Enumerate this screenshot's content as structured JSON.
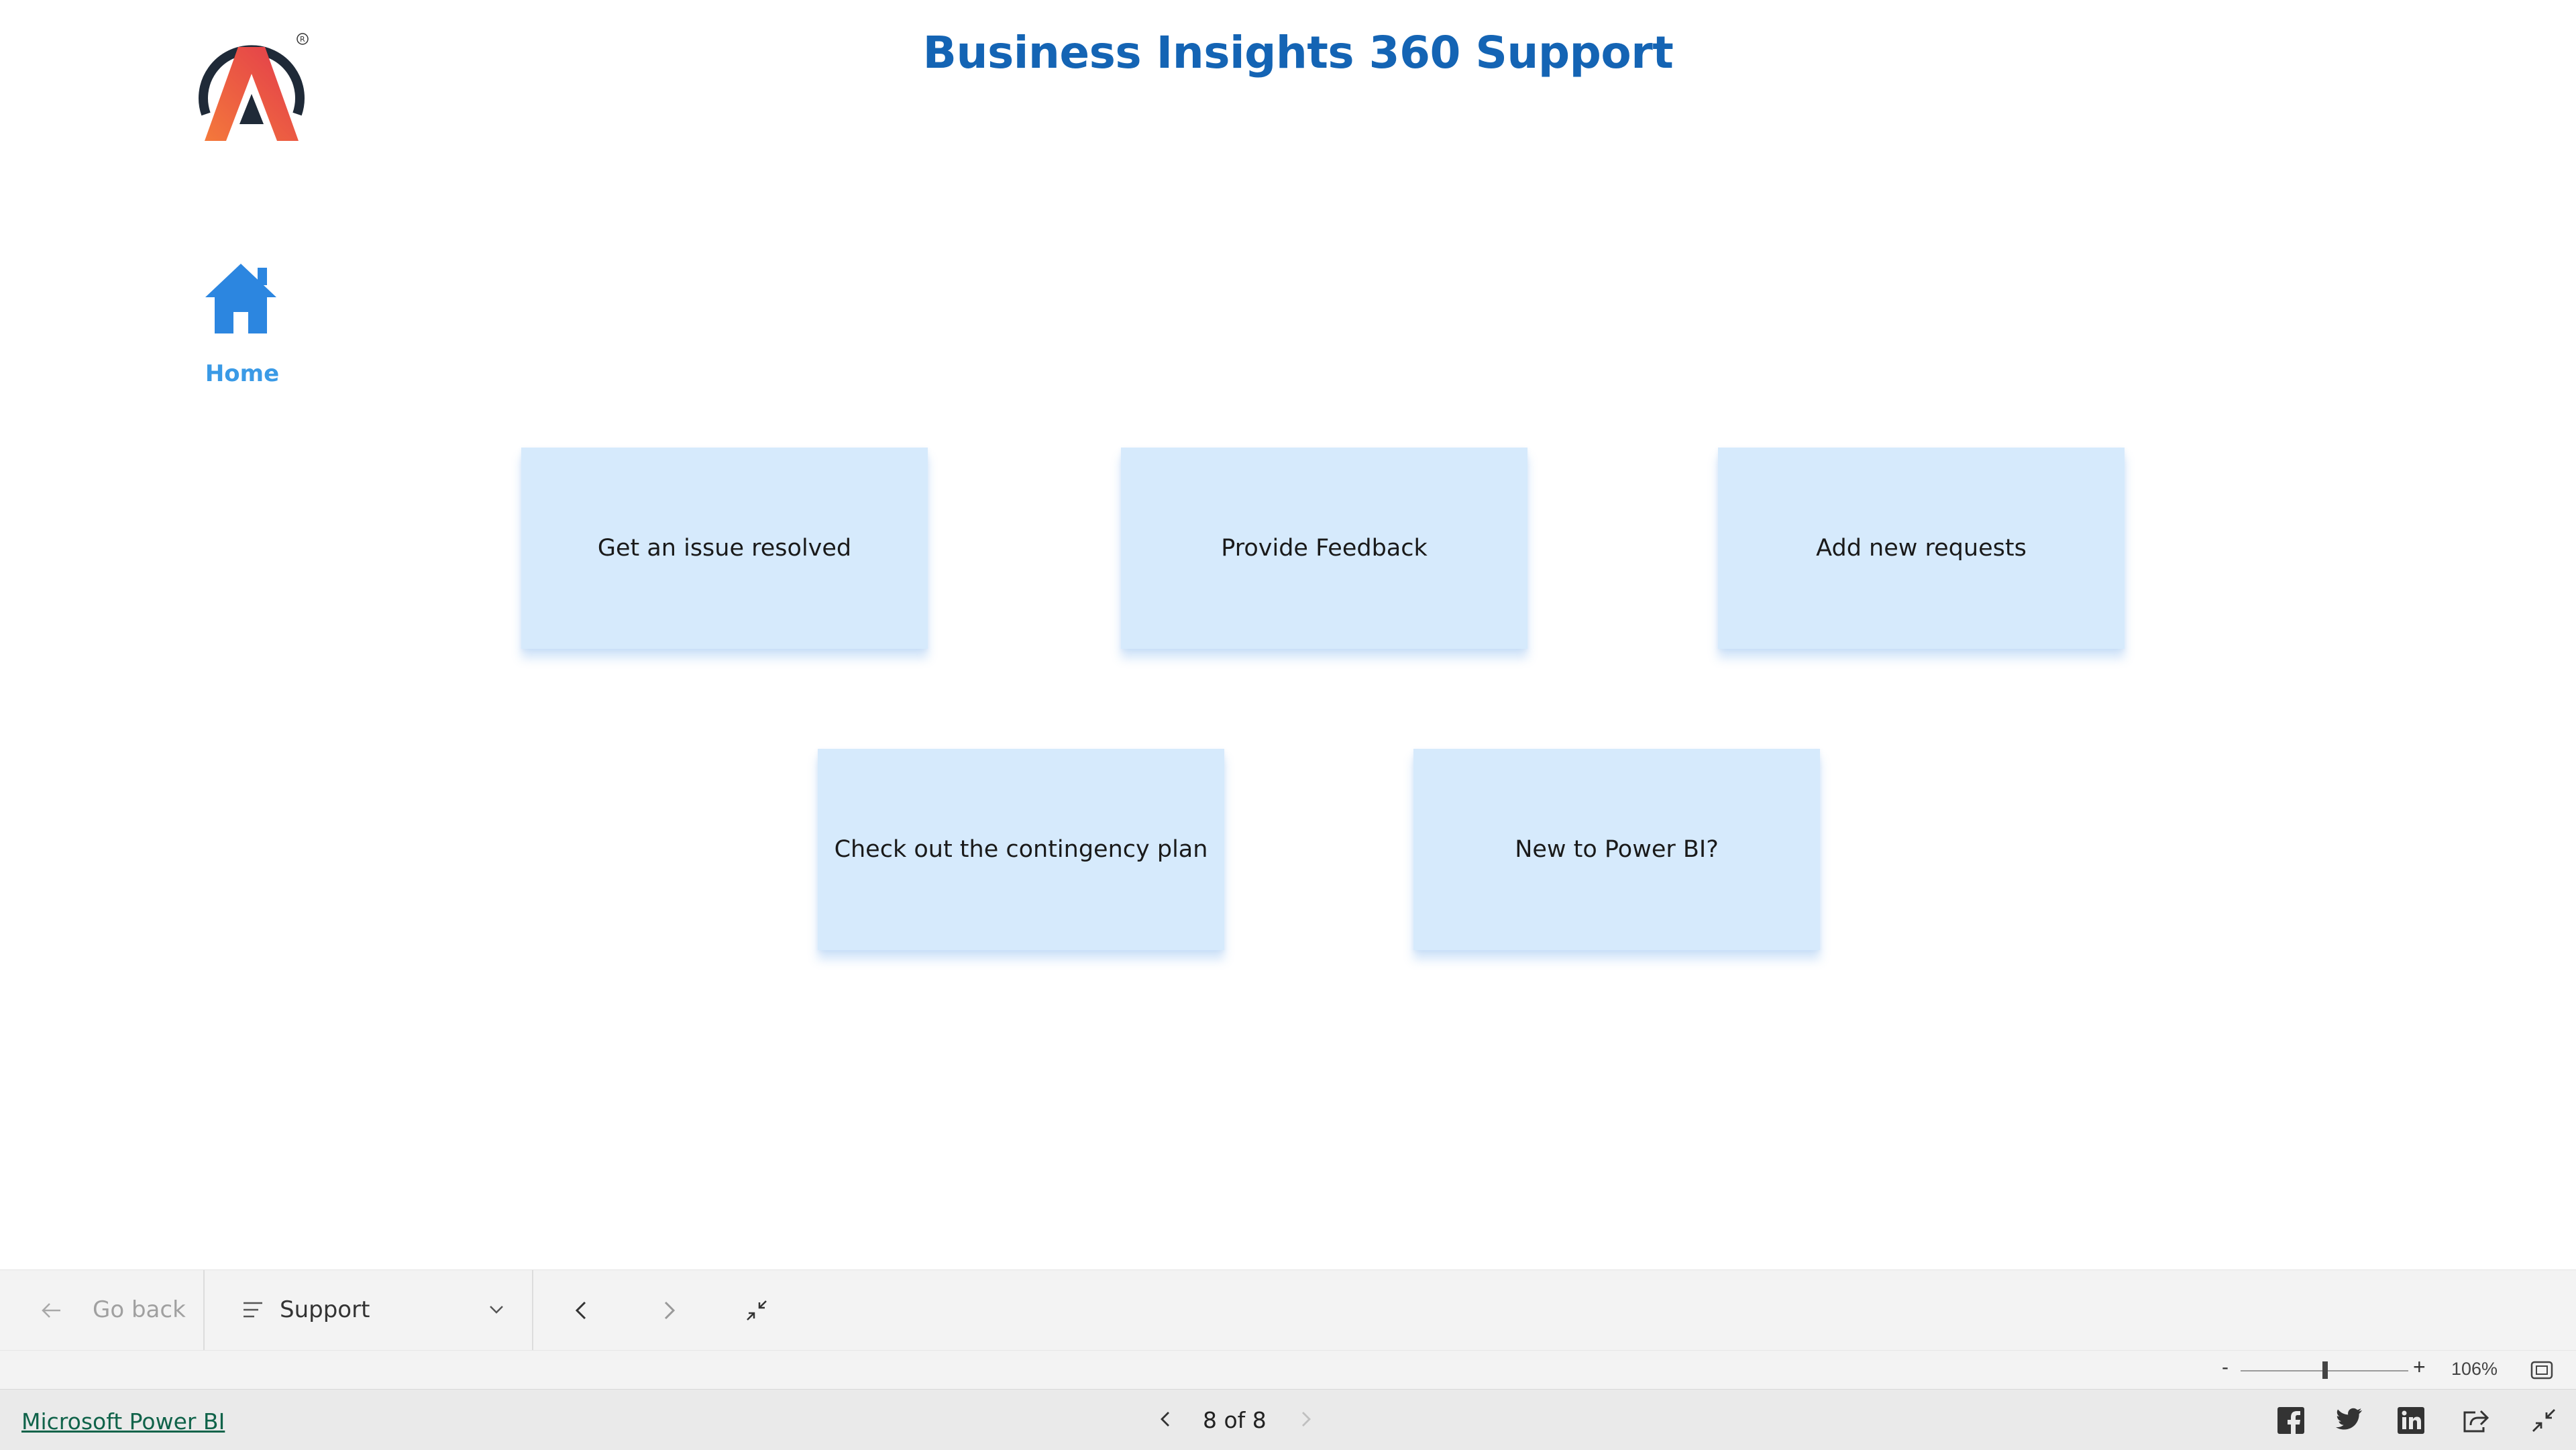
{
  "report": {
    "title": "Business Insights 360 Support",
    "logo_icon": "atliq-logo-icon",
    "home": {
      "icon": "home-icon",
      "label": "Home"
    },
    "cards": [
      {
        "label": "Get an issue resolved"
      },
      {
        "label": "Provide Feedback"
      },
      {
        "label": "Add new requests"
      },
      {
        "label": "Check out the contingency plan"
      },
      {
        "label": "New to Power BI?"
      }
    ],
    "colors": {
      "title": "#1464b4",
      "card_bg": "#d6eafc",
      "home_accent": "#3a9ae6",
      "logo_orange": "#f2593a",
      "logo_dark": "#1f2a38"
    }
  },
  "navbar": {
    "go_back_label": "Go back",
    "page_select_label": "Support",
    "icons": [
      "arrow-left-icon",
      "list-icon",
      "chevron-down-icon",
      "chevron-left-icon",
      "chevron-right-icon",
      "collapse-icon"
    ]
  },
  "zoom": {
    "minus": "-",
    "plus": "+",
    "level": "106%"
  },
  "footer": {
    "link": "Microsoft Power BI",
    "page_indicator": "8 of 8",
    "icons": [
      "facebook-icon",
      "twitter-icon",
      "linkedin-icon",
      "share-icon",
      "exit-fullscreen-icon"
    ]
  }
}
